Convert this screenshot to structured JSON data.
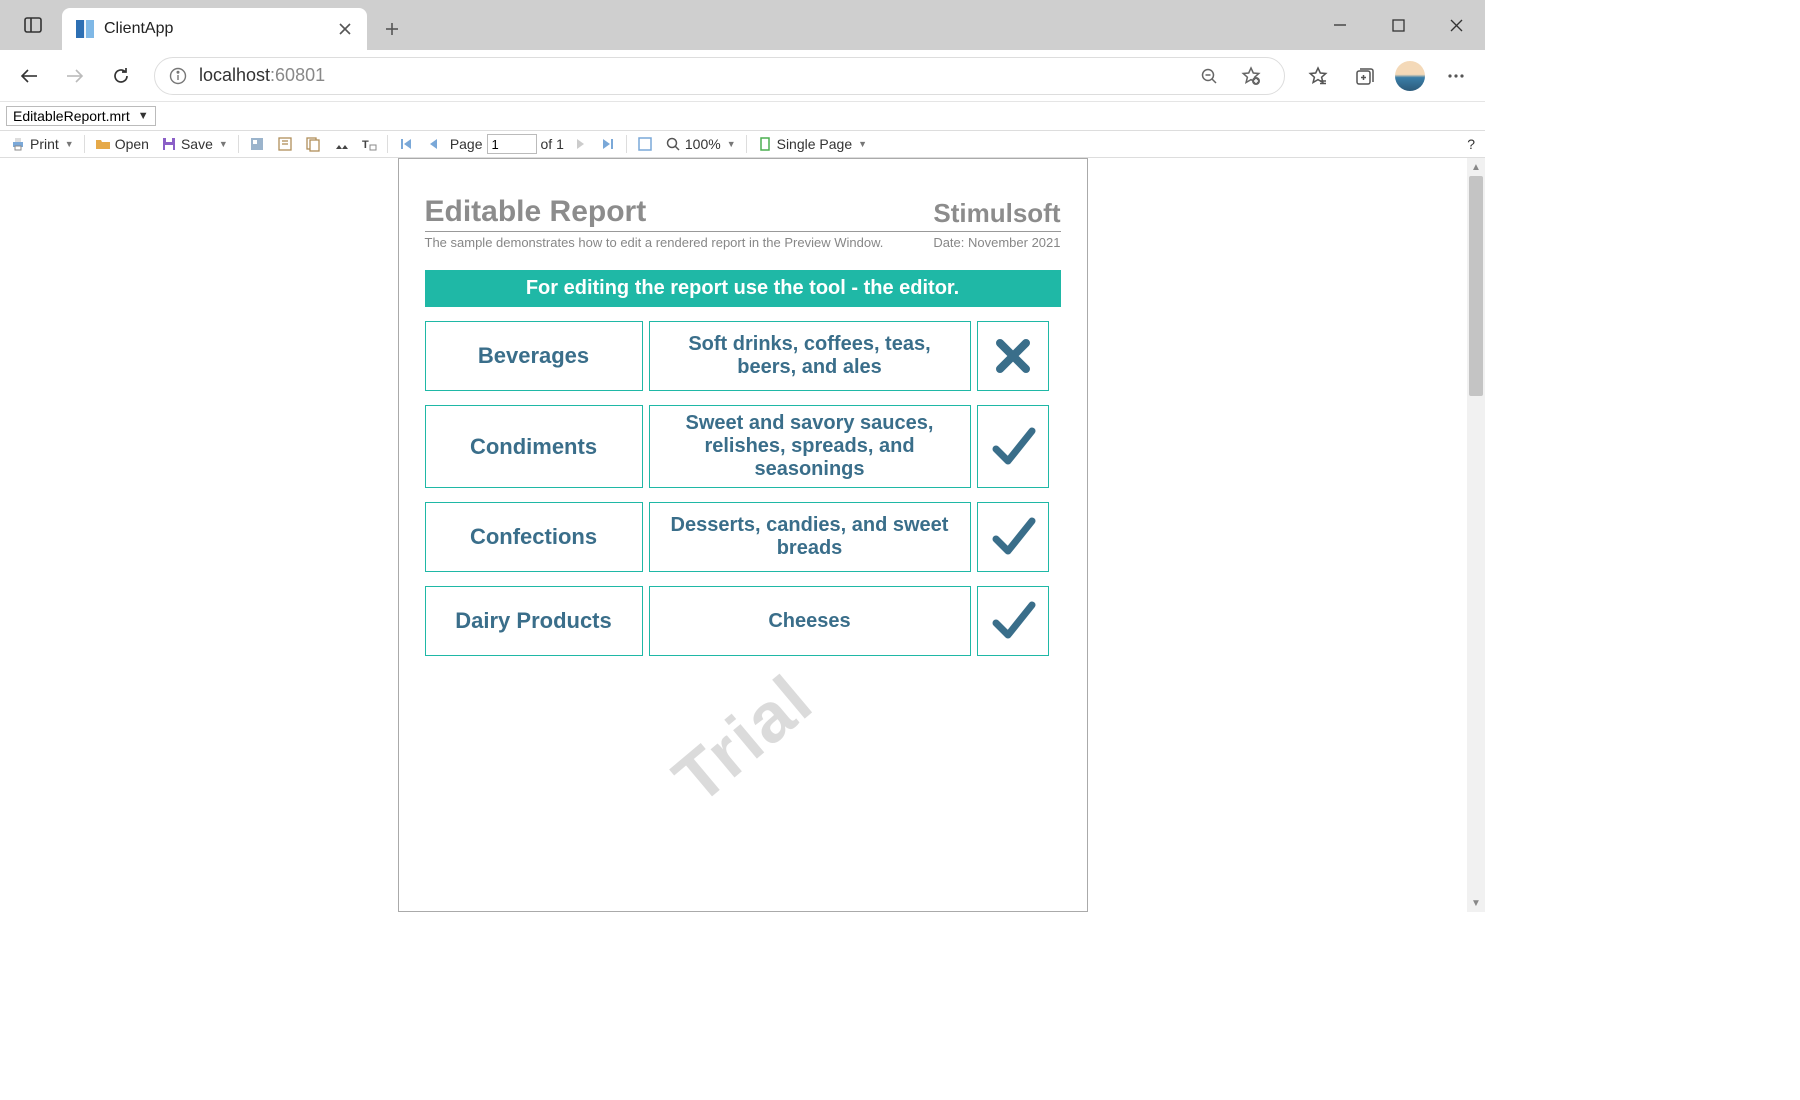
{
  "browser": {
    "tab_title": "ClientApp",
    "url_host": "localhost",
    "url_port": ":60801"
  },
  "file_dropdown": "EditableReport.mrt",
  "toolbar": {
    "print": "Print",
    "open": "Open",
    "save": "Save",
    "page_label": "Page",
    "page_value": "1",
    "page_of": "of 1",
    "zoom": "100%",
    "view_mode": "Single Page",
    "help": "?"
  },
  "report": {
    "title": "Editable Report",
    "brand": "Stimulsoft",
    "subtitle": "The sample demonstrates how to edit a rendered report in the Preview Window.",
    "date_label": "Date: November 2021",
    "banner": "For editing the report use the tool - the editor.",
    "watermark": "Trial",
    "rows": [
      {
        "name": "Beverages",
        "desc": "Soft drinks, coffees, teas, beers, and ales",
        "checked": false
      },
      {
        "name": "Condiments",
        "desc": "Sweet and savory sauces, relishes, spreads, and seasonings",
        "checked": true
      },
      {
        "name": "Confections",
        "desc": "Desserts, candies, and sweet breads",
        "checked": true
      },
      {
        "name": "Dairy Products",
        "desc": "Cheeses",
        "checked": true
      }
    ]
  }
}
